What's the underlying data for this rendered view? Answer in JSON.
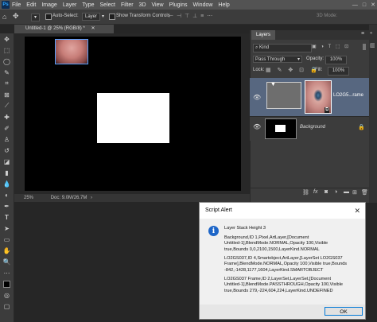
{
  "app": {
    "logo": "Ps",
    "menu": [
      "File",
      "Edit",
      "Image",
      "Layer",
      "Type",
      "Select",
      "Filter",
      "3D",
      "View",
      "Plugins",
      "Window",
      "Help"
    ]
  },
  "window_controls": {
    "minimize": "—",
    "maximize": "□",
    "close": "✕"
  },
  "options_bar": {
    "auto_select_label": "Auto-Select:",
    "auto_select_target": "Layer",
    "show_transform_label": "Show Transform Controls",
    "mode_3d": "3D Mode:"
  },
  "document": {
    "tab_title": "Untitled-1 @ 25% (RGB/8) *",
    "zoom": "25%",
    "doc_info": "Doc: 9.0M/26.7M"
  },
  "layers_panel": {
    "tab_label": "Layers",
    "filter_kind": "Kind",
    "blend_mode": "Pass Through",
    "opacity_label": "Opacity:",
    "opacity_value": "100%",
    "lock_label": "Lock:",
    "fill_label": "Fill:",
    "fill_value": "100%",
    "layers": [
      {
        "name": "LO2G5...rame",
        "selected": true
      },
      {
        "name": "Background",
        "selected": false
      }
    ],
    "footer_icons": [
      "link-icon",
      "fx-icon",
      "mask-icon",
      "adjustment-icon",
      "folder-icon",
      "new-layer-icon",
      "trash-icon"
    ]
  },
  "dialog": {
    "title": "Script Alert",
    "close": "✕",
    "icon": "i",
    "line1": "Layer Stack Height 3",
    "para1": "Background,ID 1,Pixel,ArtLayer,[Document\nUntitled-1],BlendMode.NORMAL,Opacity 100,Visible\ntrue,Bounds 0,0,2100,1500,LayerKind.NORMAL",
    "para2": "LO2GS037,ID 4,Smartobject,ArtLayer,[LayerSet LO2GS037\nFrame],BlendMode.NORMAL,Opacity 100,Visible true,Bounds\n-842,-1428,1177,1604,LayerKind.SMARTOBJECT",
    "para3": "LO2GS037 Frame,ID 2,LayerSet,LayerSet,[Document\nUntitled-1],BlendMode.PASSTHROUGH,Opacity 100,Visible\ntrue,Bounds 279,-224,604,224,LayerKind.UNDEFINED",
    "ok": "OK"
  }
}
